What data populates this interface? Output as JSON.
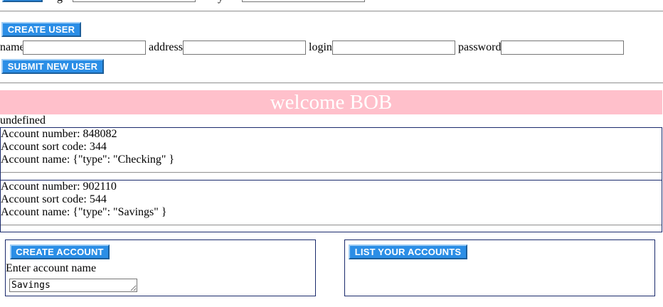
{
  "top_bar": {
    "partial_field_1": "",
    "partial_field_2": ""
  },
  "create_user": {
    "button_label": "CREATE USER",
    "name_label": "name",
    "address_label": "address",
    "login_label": "login",
    "password_label": "password",
    "name_value": "",
    "address_value": "",
    "login_value": "",
    "password_value": "",
    "submit_label": "SUBMIT NEW USER"
  },
  "welcome": {
    "text": "welcome BOB",
    "background": "#ffc0cb",
    "color": "#ffffff"
  },
  "status_text": "undefined",
  "accounts": [
    {
      "number_line": "Account number: 848082",
      "sort_line": "Account sort code: 344",
      "name_line": "Account name: {\"type\": \"Checking\" }"
    },
    {
      "number_line": "Account number: 902110",
      "sort_line": "Account sort code: 544",
      "name_line": "Account name: {\"type\": \"Savings\" }"
    }
  ],
  "create_account": {
    "button_label": "CREATE ACCOUNT",
    "prompt": "Enter account name",
    "value": "Savings"
  },
  "list_accounts": {
    "button_label": "LIST YOUR ACCOUNTS"
  },
  "colors": {
    "button_bg": "#2b8ee6",
    "border_dark": "#1a2a6c"
  }
}
